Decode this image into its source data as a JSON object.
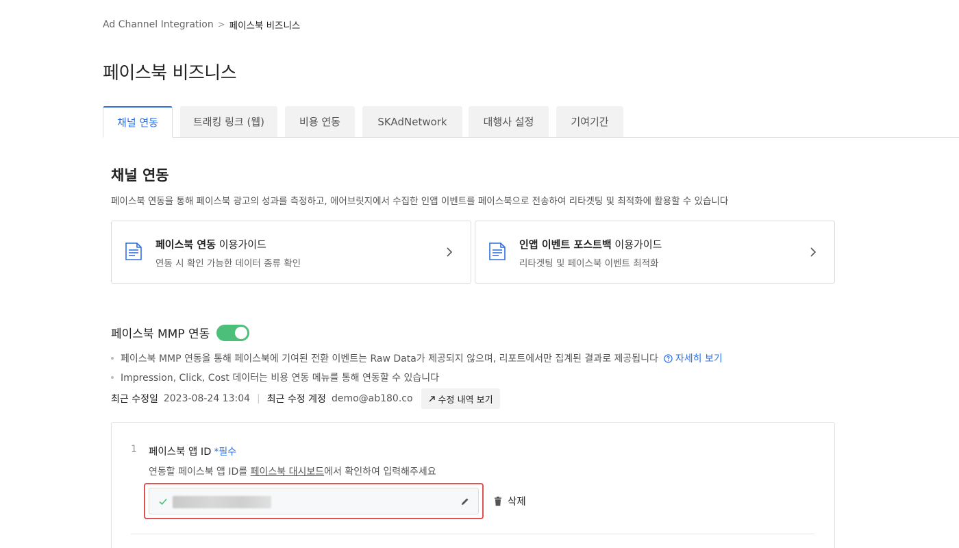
{
  "breadcrumb": {
    "parent": "Ad Channel Integration",
    "separator": ">",
    "current": "페이스북 비즈니스"
  },
  "page_title": "페이스북 비즈니스",
  "tabs": [
    {
      "label": "채널 연동",
      "active": true
    },
    {
      "label": "트래킹 링크 (웹)",
      "active": false
    },
    {
      "label": "비용 연동",
      "active": false
    },
    {
      "label": "SKAdNetwork",
      "active": false
    },
    {
      "label": "대행사 설정",
      "active": false
    },
    {
      "label": "기여기간",
      "active": false
    }
  ],
  "section": {
    "title": "채널 연동",
    "description": "페이스북 연동을 통해 페이스북 광고의 성과를 측정하고, 에어브릿지에서 수집한 인앱 이벤트를 페이스북으로 전송하여 리타겟팅 및 최적화에 활용할 수 있습니다"
  },
  "guides": [
    {
      "title_bold": "페이스북 연동",
      "title_rest": " 이용가이드",
      "subtitle": "연동 시 확인 가능한 데이터 종류 확인",
      "icon": "document-icon"
    },
    {
      "title_bold": "인앱 이벤트 포스트백",
      "title_rest": " 이용가이드",
      "subtitle": "리타겟팅 및 페이스북 이벤트 최적화",
      "icon": "document-icon"
    }
  ],
  "mmp": {
    "title": "페이스북 MMP 연동",
    "toggle_on": true,
    "toggle_color": "#4cc07a",
    "bullets": [
      "페이스북 MMP 연동을 통해 페이스북에 기여된 전환 이벤트는 Raw Data가 제공되지 않으며, 리포트에서만 집계된 결과로 제공됩니다",
      "Impression, Click, Cost 데이터는 비용 연동 메뉴를 통해 연동할 수 있습니다"
    ],
    "detail_link": "자세히 보기"
  },
  "meta": {
    "modified_label": "최근 수정일",
    "modified_value": "2023-08-24 13:04",
    "divider": "|",
    "account_label": "최근 수정 계정",
    "account_value": "demo@ab180.co",
    "history_button": "수정 내역 보기"
  },
  "form": {
    "number": "1",
    "label": "페이스북 앱 ID",
    "required": "*필수",
    "help_prefix": "연동할 페이스북 앱 ID를 ",
    "help_link": "페이스북 대시보드",
    "help_suffix": "에서 확인하여 입력해주세요",
    "delete_label": "삭제"
  },
  "colors": {
    "accent": "#2f6fe0",
    "highlight": "#e05252",
    "check": "#4cc07a"
  }
}
